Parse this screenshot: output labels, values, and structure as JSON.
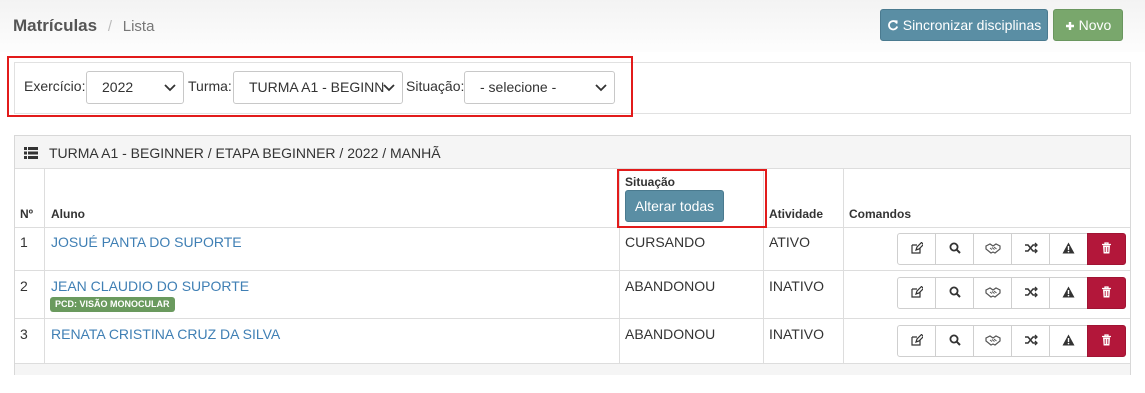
{
  "breadcrumb": {
    "title": "Matrículas",
    "separator": "/",
    "current": "Lista"
  },
  "header_buttons": {
    "sync_label": "Sincronizar disciplinas",
    "new_label": "Novo"
  },
  "filters": {
    "exercicio_label": "Exercício:",
    "exercicio_value": "2022",
    "turma_label": "Turma:",
    "turma_value": "TURMA A1 - BEGINN",
    "situacao_label": "Situação:",
    "situacao_value": "- selecione -"
  },
  "panel": {
    "title": "TURMA A1 - BEGINNER / ETAPA BEGINNER / 2022 / MANHÃ"
  },
  "table": {
    "headers": {
      "num": "Nº",
      "aluno": "Aluno",
      "situacao": "Situação",
      "atividade": "Atividade",
      "comandos": "Comandos"
    },
    "alter_all_label": "Alterar todas",
    "rows": [
      {
        "num": "1",
        "aluno": "JOSUÉ PANTA DO SUPORTE",
        "badge": "",
        "situacao": "CURSANDO",
        "atividade": "ATIVO"
      },
      {
        "num": "2",
        "aluno": "JEAN CLAUDIO DO SUPORTE",
        "badge": "PCD: VISÃO MONOCULAR",
        "situacao": "ABANDONOU",
        "atividade": "INATIVO"
      },
      {
        "num": "3",
        "aluno": "RENATA CRISTINA CRUZ DA SILVA",
        "badge": "",
        "situacao": "ABANDONOU",
        "atividade": "INATIVO"
      }
    ]
  },
  "icons": {
    "sync": "refresh-icon",
    "new": "plus-icon",
    "list": "list-icon",
    "commands": [
      "edit-icon",
      "search-icon",
      "handshake-icon",
      "shuffle-icon",
      "warning-icon",
      "trash-icon"
    ]
  },
  "colors": {
    "primary": "#5a8ea4",
    "success": "#79a76c",
    "danger": "#b3173a",
    "link": "#3f7fb4",
    "highlight": "#e21b1b"
  }
}
